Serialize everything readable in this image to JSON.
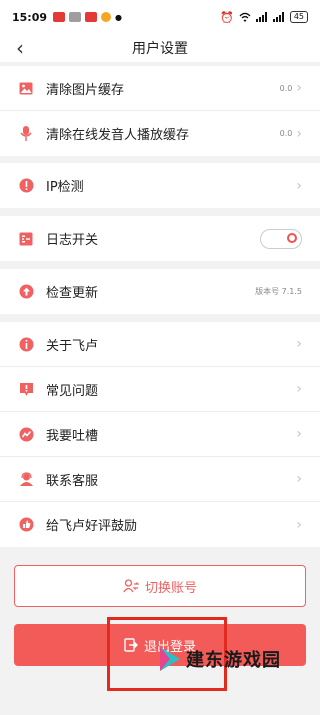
{
  "status_bar": {
    "time": "15:09",
    "battery": "45"
  },
  "nav": {
    "title": "用户设置"
  },
  "cache_group": [
    {
      "label": "清除图片缓存",
      "value": "0.0",
      "icon": "image-icon"
    },
    {
      "label": "清除在线发音人播放缓存",
      "value": "0.0",
      "icon": "microphone-icon"
    }
  ],
  "ip_check": {
    "label": "IP检测",
    "icon": "alert-circle-icon"
  },
  "log_switch": {
    "label": "日志开关",
    "icon": "log-list-icon",
    "enabled": false
  },
  "update": {
    "label": "检查更新",
    "value": "版本号 7.1.5",
    "icon": "upload-icon"
  },
  "info_group": [
    {
      "label": "关于飞卢",
      "icon": "info-icon"
    },
    {
      "label": "常见问题",
      "icon": "question-bubble-icon"
    },
    {
      "label": "我要吐槽",
      "icon": "feedback-icon"
    },
    {
      "label": "联系客服",
      "icon": "customer-service-icon"
    },
    {
      "label": "给飞卢好评鼓励",
      "icon": "like-icon"
    }
  ],
  "buttons": {
    "switch_account": "切换账号",
    "logout": "退出登录"
  },
  "watermark": {
    "text": "建东游戏园"
  },
  "colors": {
    "accent": "#f25b58",
    "annotation": "#e12b1f",
    "background": "#f2f2f2"
  }
}
